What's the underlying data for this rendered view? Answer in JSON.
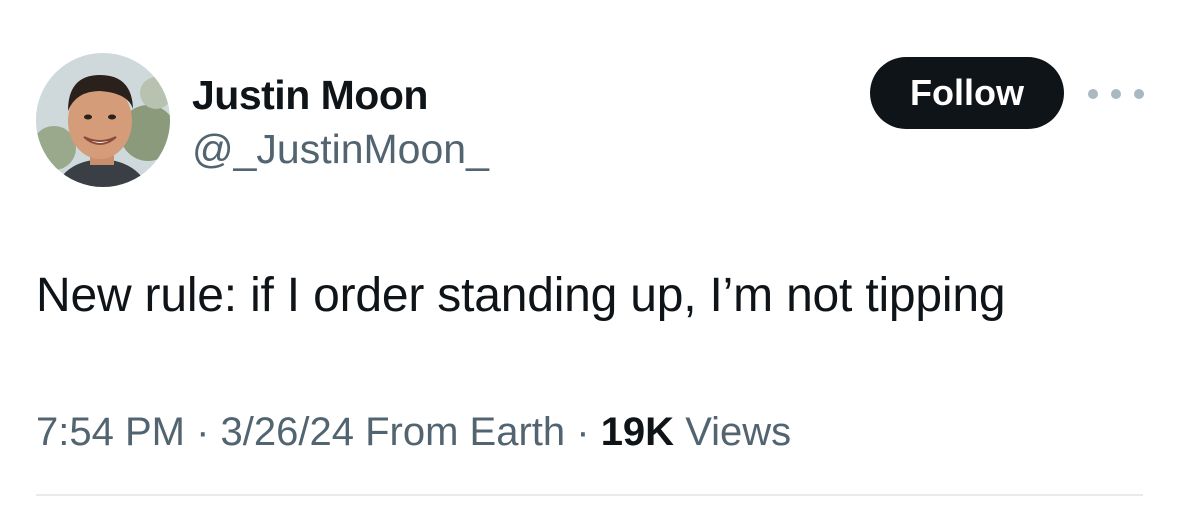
{
  "author": {
    "display_name": "Justin Moon",
    "handle": "@_JustinMoon_"
  },
  "actions": {
    "follow_label": "Follow",
    "more_icon": "ellipsis-icon"
  },
  "tweet": {
    "text": "New rule: if I order standing up, I’m not tipping"
  },
  "meta": {
    "time": "7:54 PM",
    "sep1": " · ",
    "date": "3/26/24",
    "source": " From Earth",
    "sep2": " · ",
    "views_count": "19K",
    "views_label": " Views"
  },
  "colors": {
    "text": "#0f1419",
    "secondary": "#536471",
    "divider": "#e7ebee",
    "follow_bg": "#0f1419"
  }
}
